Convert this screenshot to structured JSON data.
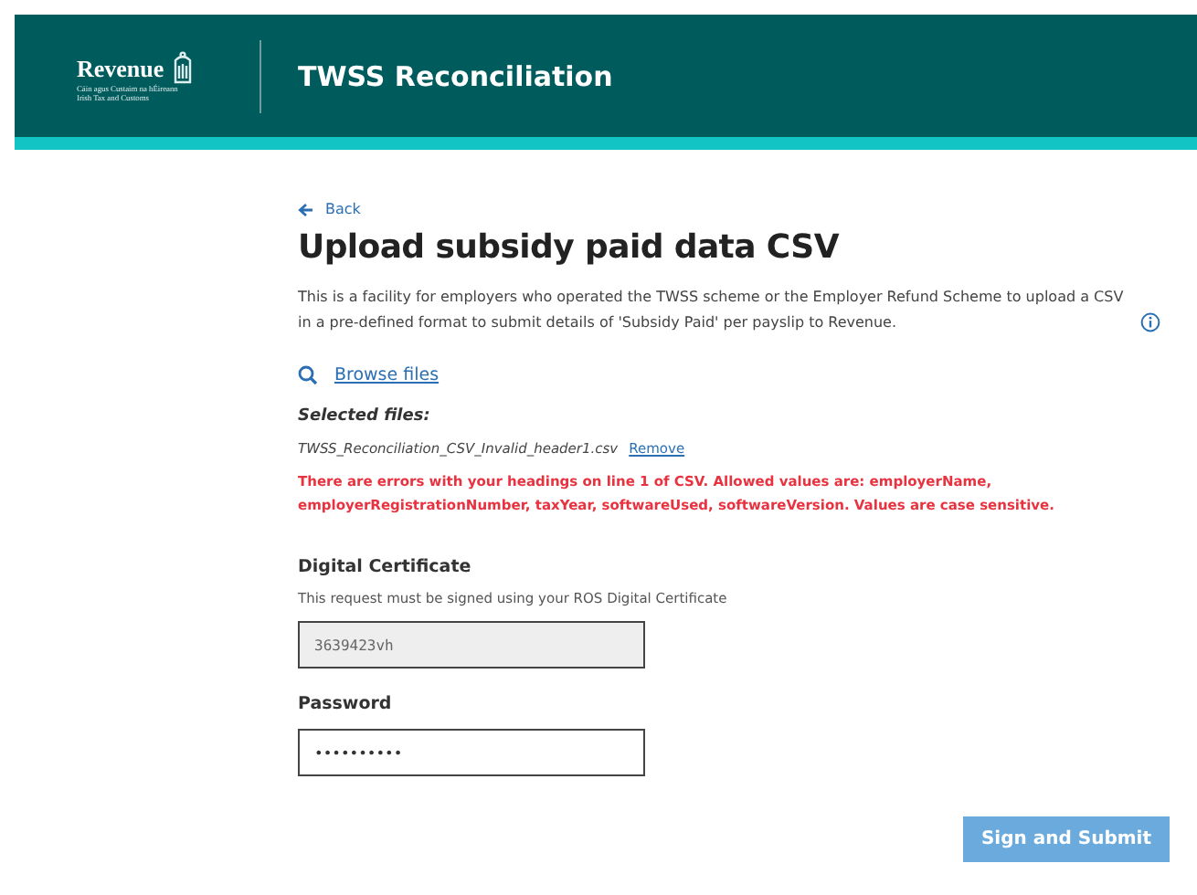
{
  "header": {
    "logo": {
      "name": "Revenue",
      "line_1": "Cáin agus Custaim na hÉireann",
      "line_2": "Irish Tax and Customs"
    },
    "title": "TWSS Reconciliation"
  },
  "back_link": "Back",
  "heading": "Upload subsidy paid data CSV",
  "intro": "This is a facility for employers who operated the TWSS scheme or the Employer Refund Scheme to upload a CSV in a pre-defined format to submit details of 'Subsidy Paid' per payslip to Revenue.",
  "browse_link": "Browse files",
  "selected_files": {
    "label": "Selected files:",
    "files": [
      {
        "name": "TWSS_Reconciliation_CSV_Invalid_header1.csv",
        "action": "Remove"
      }
    ]
  },
  "error": "There are errors with your headings on line 1 of CSV. Allowed values are: employerName, employerRegistrationNumber, taxYear, softwareUsed, softwareVersion. Values are case sensitive.",
  "certificate": {
    "label": "Digital Certificate",
    "hint": "This request must be signed using your ROS Digital Certificate",
    "value": "3639423vh",
    "disabled": true
  },
  "password": {
    "label": "Password",
    "value": "••••••••••",
    "disabled": false
  },
  "submit": {
    "label": "Sign and Submit",
    "disabled": true
  }
}
